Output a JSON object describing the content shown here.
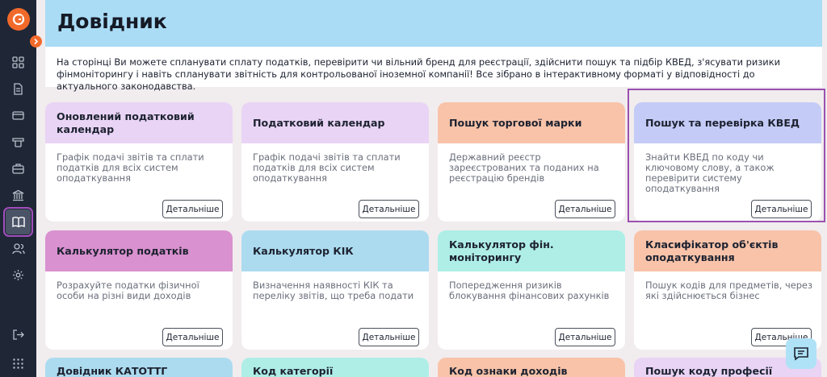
{
  "sidebar": {
    "logo": "logo-icon",
    "items": [
      {
        "name": "grid-icon"
      },
      {
        "name": "document-icon"
      },
      {
        "name": "card-icon"
      },
      {
        "name": "trademark-icon"
      },
      {
        "name": "briefcase-icon"
      },
      {
        "name": "bank-icon"
      },
      {
        "name": "book-icon",
        "active": true
      },
      {
        "name": "users-icon"
      },
      {
        "name": "settings-icon"
      },
      {
        "name": "logout-icon"
      },
      {
        "name": "apps-grid-icon"
      }
    ]
  },
  "header": {
    "title": "Довідник"
  },
  "intro": {
    "text": "На сторінці Ви можете спланувати сплату податків, перевірити чи вільний бренд для реєстрації, здійснити пошук та підбір КВЕД, з'ясувати ризики фінмоніторингу і навіть спланувати звітність для контрольованої іноземної компанії! Все зібрано в інтерактивному форматі у відповідності до актуального законодавства."
  },
  "cards": [
    {
      "title": "Оновлений податковий календар",
      "desc": "Графік подачі звітів та сплати податків для всіх систем оподаткування",
      "button": "Детальніше",
      "color": "#e9d4f5"
    },
    {
      "title": "Податковий календар",
      "desc": "Графік подачі звітів та сплати податків для всіх систем оподаткування",
      "button": "Детальніше",
      "color": "#e9d4f5"
    },
    {
      "title": "Пошук торгової марки",
      "desc": "Державний реєстр зареєстрованих та поданих на реєстрацію брендів",
      "button": "Детальніше",
      "color": "#f8c3a9"
    },
    {
      "title": "Пошук та перевірка КВЕД",
      "desc": "Знайти КВЕД по коду чи ключовому слову, а також перевірити систему оподаткування",
      "button": "Детальніше",
      "color": "#c4cbf6"
    },
    {
      "title": "Калькулятор податків",
      "desc": "Розрахуйте податки фізичної особи на різні види доходів",
      "button": "Детальніше",
      "color": "#d991cf"
    },
    {
      "title": "Калькулятор КІК",
      "desc": "Визначення наявності КІК та переліку звітів, що треба подати",
      "button": "Детальніше",
      "color": "#acdbef"
    },
    {
      "title": "Калькулятор фін. моніторингу",
      "desc": "Попередження ризиків блокування фінансових рахунків",
      "button": "Детальніше",
      "color": "#aeeee6"
    },
    {
      "title": "Класифікатор об'єктів оподаткування",
      "desc": "Пошук кодів для предметів, через які здійснюється бізнес",
      "button": "Детальніше",
      "color": "#f8c3a9"
    },
    {
      "title": "Довідник КАТОТТГ",
      "desc": "",
      "button": "",
      "color": "#acdbef"
    },
    {
      "title": "Код категорії застрахованої",
      "desc": "",
      "button": "",
      "color": "#aeeee6"
    },
    {
      "title": "Код ознаки доходів",
      "desc": "",
      "button": "",
      "color": "#f8c3a9"
    },
    {
      "title": "Пошук коду професії",
      "desc": "",
      "button": "",
      "color": "#e9d4f5"
    }
  ],
  "chat": {
    "icon": "chat-icon"
  }
}
